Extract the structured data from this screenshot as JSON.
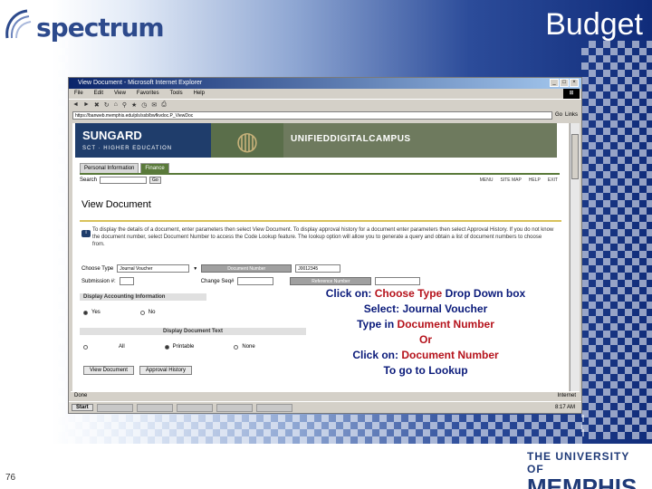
{
  "slide": {
    "title": "Budget",
    "logo_text": "spectrum",
    "slide_number": "76",
    "university_top": "THE UNIVERSITY OF",
    "university_main": "MEMPHIS"
  },
  "browser": {
    "title": "View Document - Microsoft Internet Explorer",
    "menu": [
      "File",
      "Edit",
      "View",
      "Favorites",
      "Tools",
      "Help"
    ],
    "address": "https://banweb.memphis.edu/pls/ssb/bwfkvdoc.P_ViewDoc",
    "go_label": "Go",
    "links_label": "Links",
    "status_left": "Done",
    "status_right": "Internet"
  },
  "page": {
    "banner_left": "SUNGARD",
    "banner_sub": "SCT · HIGHER EDUCATION",
    "banner_right": "UNIFIEDDIGITALCAMPUS",
    "tabs": [
      "Personal Information",
      "Finance"
    ],
    "search_label": "Search",
    "search_go": "Go",
    "top_links": [
      "MENU",
      "SITE MAP",
      "HELP",
      "EXIT"
    ],
    "title": "View Document",
    "instructions": "To display the details of a document, enter parameters then select View Document. To display approval history for a document enter parameters then select Approval History. If you do not know the document number, select Document Number to access the Code Lookup feature. The lookup option will allow you to generate a query and obtain a list of document numbers to choose from.",
    "choose_type_label": "Choose Type",
    "choose_type_value": "Journal Voucher",
    "document_number_btn": "Document Number",
    "document_number_value": "J0012345",
    "submission_label": "Submission #:",
    "change_seq_label": "Change Seq#",
    "reference_number_btn": "Reference Number",
    "accounting_header": "Display Accounting Information",
    "yes_label": "Yes",
    "no_label": "No",
    "text_header": "Display Document Text",
    "all_label": "All",
    "printable_label": "Printable",
    "none_label": "None",
    "view_document_btn": "View Document",
    "approval_history_btn": "Approval History"
  },
  "callout": {
    "line1_a": "Click on: ",
    "line1_b": "Choose Type",
    "line1_c": " Drop Down box",
    "line2_a": "Select:  ",
    "line2_b": "Journal Voucher",
    "line3_a": "Type in ",
    "line3_b": "Document Number",
    "line4": "Or",
    "line5_a": "Click on: ",
    "line5_b": "Document Number",
    "line6_a": "To go to ",
    "line6_b": "Lookup"
  },
  "taskbar": {
    "start": "Start",
    "clock": "8:17 AM"
  }
}
